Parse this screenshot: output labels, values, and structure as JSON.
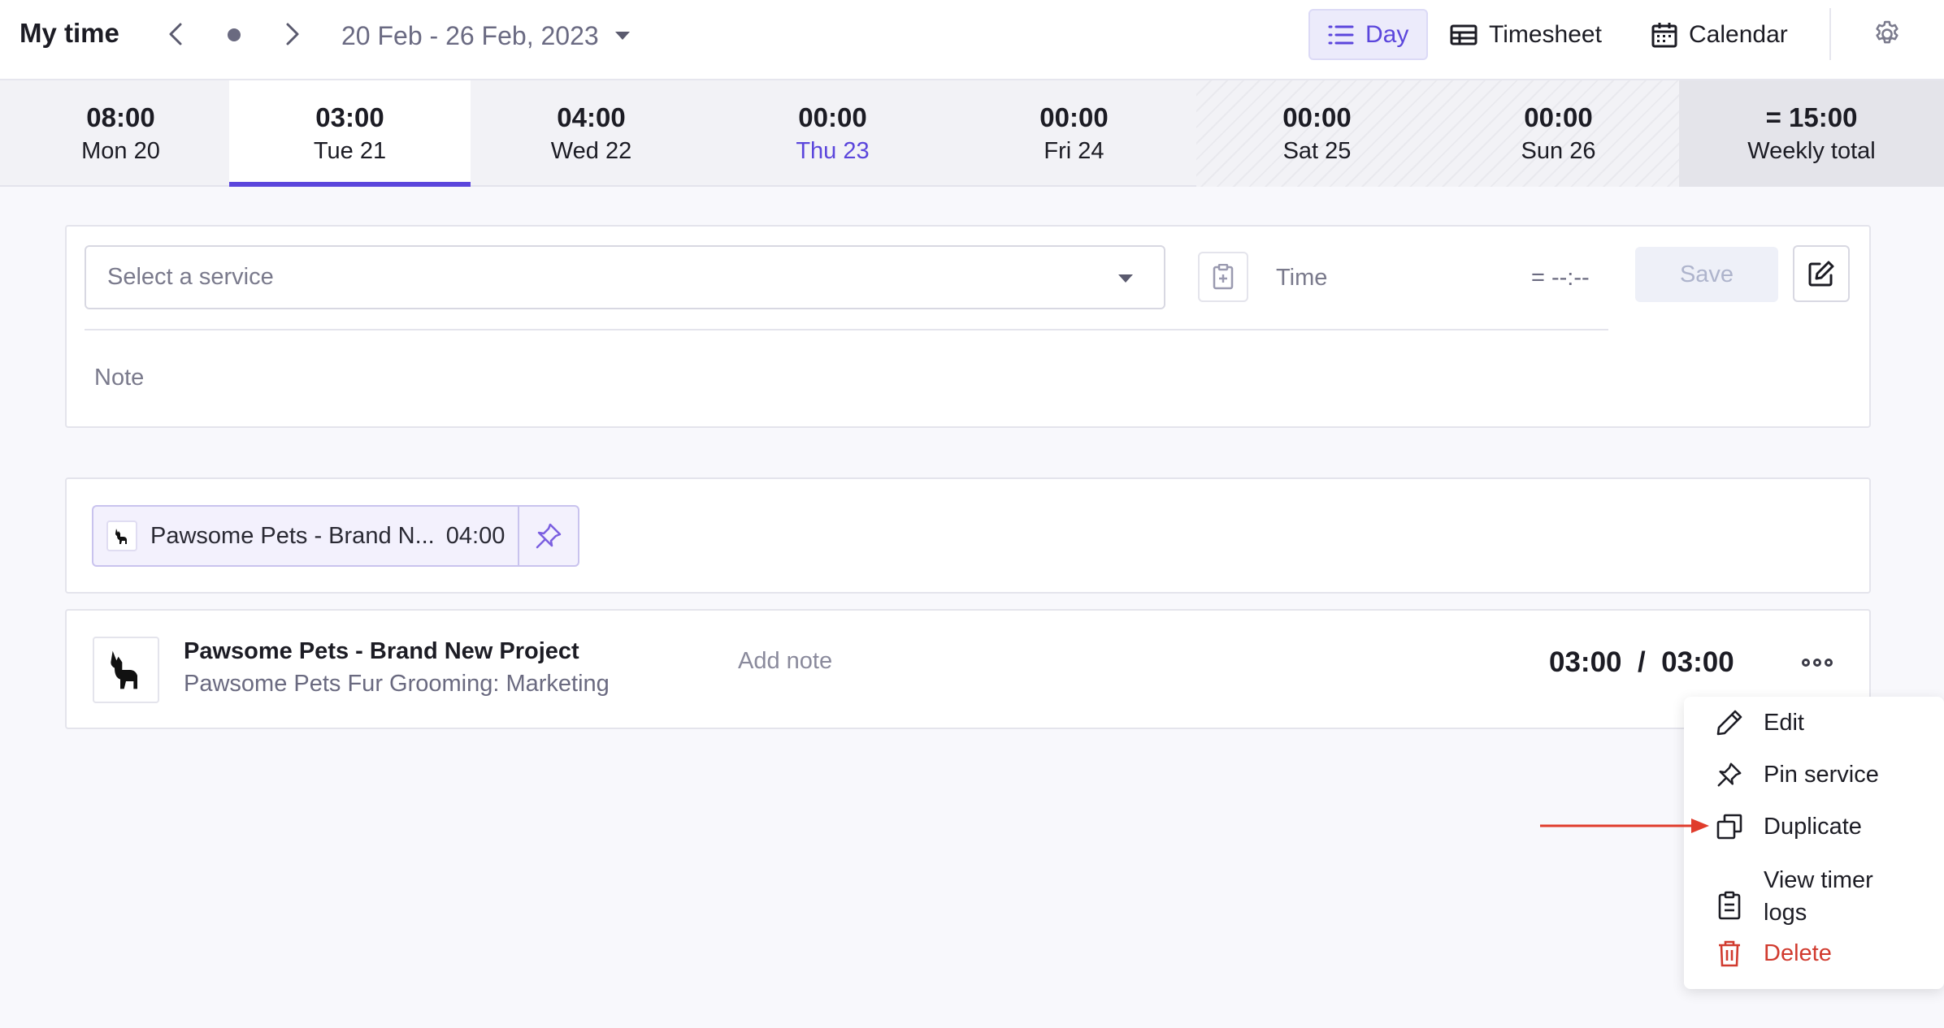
{
  "app": {
    "title": "My time"
  },
  "nav": {
    "date_range": "20 Feb - 26 Feb, 2023",
    "views": [
      {
        "label": "Day",
        "icon": "list-icon",
        "active": true
      },
      {
        "label": "Timesheet",
        "icon": "table-icon"
      },
      {
        "label": "Calendar",
        "icon": "calendar-icon"
      }
    ]
  },
  "days": [
    {
      "time": "08:00",
      "label": "Mon 20"
    },
    {
      "time": "03:00",
      "label": "Tue 21",
      "active": true
    },
    {
      "time": "04:00",
      "label": "Wed 22"
    },
    {
      "time": "00:00",
      "label": "Thu 23",
      "today": true
    },
    {
      "time": "00:00",
      "label": "Fri 24"
    },
    {
      "time": "00:00",
      "label": "Sat 25",
      "weekend": true
    },
    {
      "time": "00:00",
      "label": "Sun 26",
      "weekend": true
    }
  ],
  "weekly_total": {
    "time": "= 15:00",
    "label": "Weekly total"
  },
  "form": {
    "service_placeholder": "Select a service",
    "time_label": "Time",
    "time_value": "= --:--",
    "save_label": "Save",
    "note_placeholder": "Note"
  },
  "pinned": [
    {
      "label": "Pawsome Pets - Brand N...",
      "time": "04:00"
    }
  ],
  "entries": [
    {
      "title": "Pawsome Pets - Brand New Project",
      "subtitle": "Pawsome Pets Fur Grooming: Marketing",
      "note_placeholder": "Add note",
      "time": "03:00  /  03:00"
    }
  ],
  "menu": {
    "items": [
      {
        "label": "Edit",
        "icon": "pencil-icon"
      },
      {
        "label": "Pin service",
        "icon": "pin-icon"
      },
      {
        "label": "Duplicate",
        "icon": "duplicate-icon"
      },
      {
        "label": "View timer\nlogs",
        "icon": "clipboard-icon"
      },
      {
        "label": "Delete",
        "icon": "trash-icon",
        "danger": true
      }
    ]
  },
  "colors": {
    "accent": "#5b46dc",
    "danger": "#d13b2f",
    "arrow": "#e03c2c"
  }
}
